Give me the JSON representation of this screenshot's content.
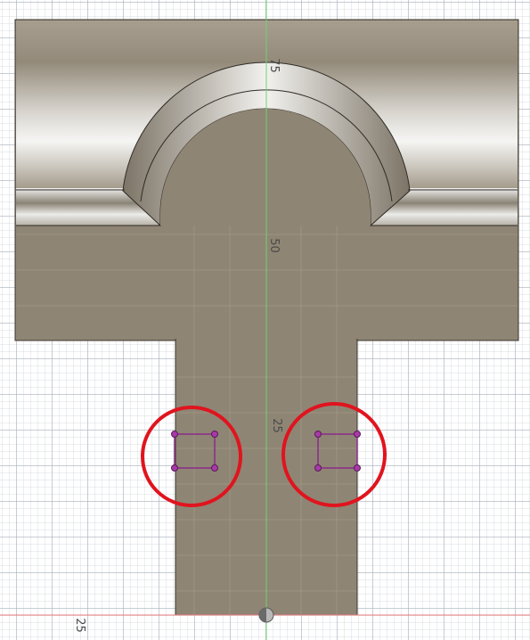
{
  "viewport": {
    "background": "#ffffff",
    "grid_color": "#c2c8d0",
    "part_color": "#8f8574",
    "sketch_color": "#8a2c8a",
    "highlight_color": "#e0141e",
    "axis_y_color": "#6fd36f",
    "axis_x_color": "#e87a7a"
  },
  "rulers": {
    "label_75": "75",
    "label_50": "50",
    "label_25_center": "25",
    "label_25_bottom": "25"
  },
  "annotations": {
    "left_circle_icon": "red-circle-annotation",
    "right_circle_icon": "red-circle-annotation"
  }
}
